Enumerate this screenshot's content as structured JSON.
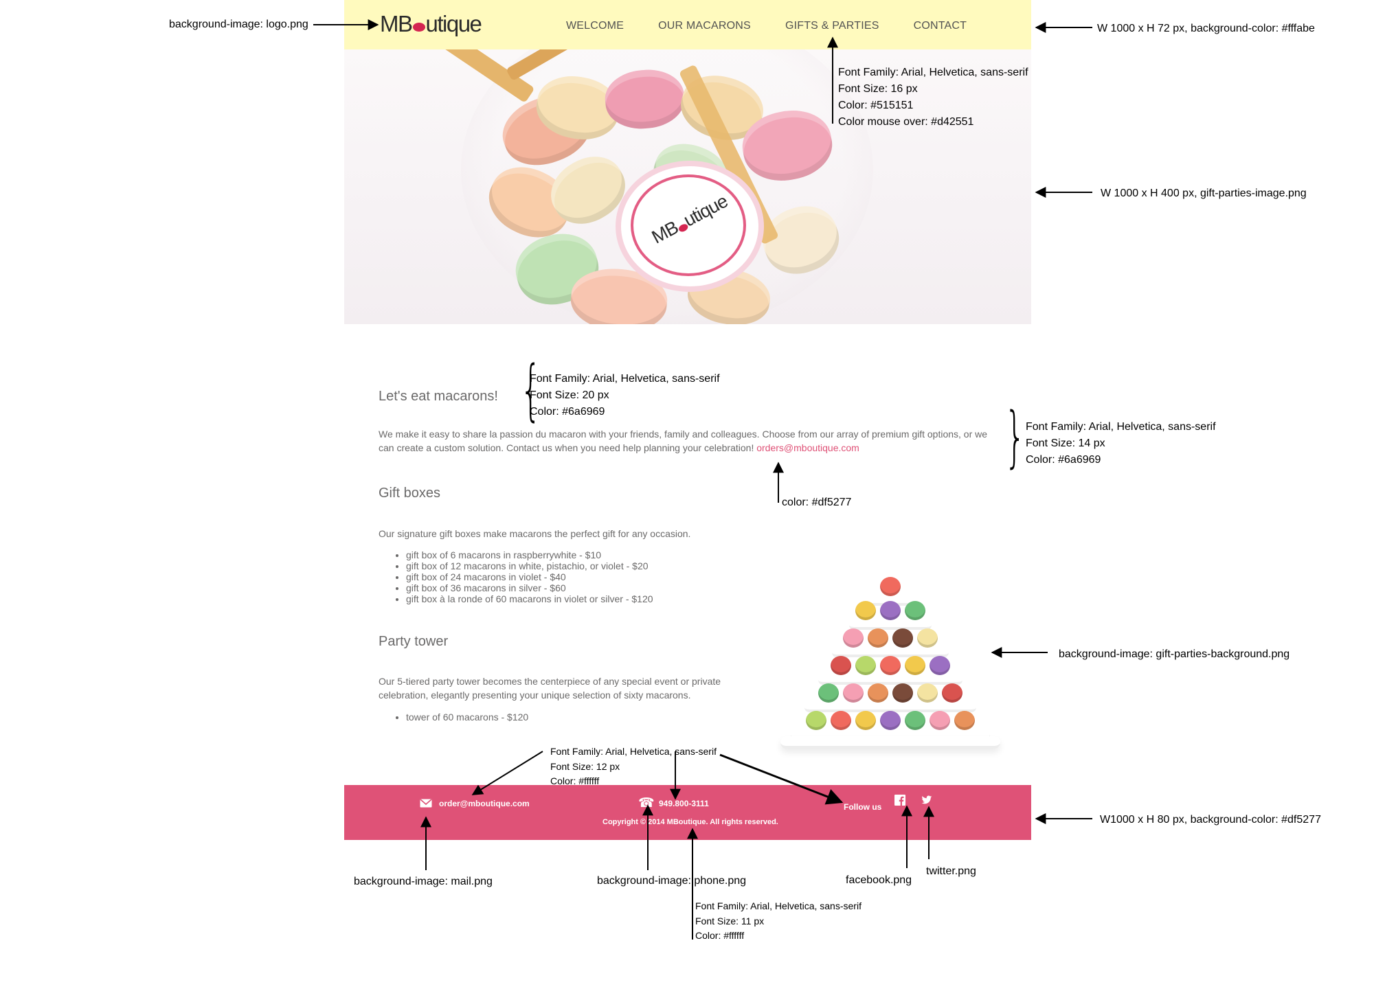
{
  "header": {
    "logo_text_left": "MB",
    "logo_text_right": "utique",
    "nav": [
      "WELCOME",
      "OUR MACARONS",
      "GIFTS & PARTIES",
      "CONTACT"
    ]
  },
  "hero": {
    "label_left": "MB",
    "label_right": "utique"
  },
  "content": {
    "title": "Let's eat macarons!",
    "intro": "We make it easy to share la passion du macaron with your friends, family and colleagues. Choose from our array of premium gift options, or we can create a custom solution. Contact us when you need help planning your celebration!",
    "email_link": "orders@mboutique.com",
    "gift_title": "Gift boxes",
    "gift_text": "Our signature gift boxes make macarons the perfect gift for any occasion.",
    "gift_items": [
      "gift box of 6 macarons in raspberrywhite - $10",
      "gift box of 12 macarons in white, pistachio, or violet - $20",
      "gift box of 24 macarons in violet - $40",
      "gift box of 36 macarons in silver - $60",
      "gift box à la ronde of 60 macarons in violet or silver - $120"
    ],
    "party_title": "Party tower",
    "party_text": "Our 5-tiered party tower becomes the centerpiece of any special event or private celebration, elegantly presenting your unique selection of sixty macarons.",
    "party_items": [
      "tower of 60 macarons - $120"
    ]
  },
  "footer": {
    "email": "order@mboutique.com",
    "phone": "949.800-3111",
    "copyright": "Copyright © 2014 MBoutique. All rights reserved.",
    "follow": "Follow us"
  },
  "annotations": {
    "logo_bg": "background-image: logo.png",
    "header_dims": "W 1000 x H 72 px, background-color: #fffabe",
    "nav_font": [
      "Font Family: Arial, Helvetica, sans-serif",
      "Font Size: 16 px",
      "Color: #515151",
      "Color mouse over: #d42551"
    ],
    "hero_dims": "W 1000 x H 400 px, gift-parties-image.png",
    "title_font": [
      "Font Family: Arial, Helvetica, sans-serif",
      "Font Size: 20 px",
      "Color: #6a6969"
    ],
    "body_font": [
      "Font Family: Arial, Helvetica, sans-serif",
      "Font Size: 14 px",
      "Color: #6a6969"
    ],
    "link_color": "color: #df5277",
    "tower_bg": "background-image: gift-parties-background.png",
    "footer_font": [
      "Font Family: Arial, Helvetica, sans-serif",
      "Font Size: 12 px",
      "Color: #ffffff"
    ],
    "footer_dims": "W1000 x H 80 px, background-color: #df5277",
    "mail_bg": "background-image: mail.png",
    "phone_bg": "background-image: phone.png",
    "facebook": "facebook.png",
    "twitter": "twitter.png",
    "copyright_font": [
      "Font Family: Arial, Helvetica, sans-serif",
      "Font Size: 11 px",
      "Color: #ffffff"
    ]
  },
  "colors": {
    "header_bg": "#fffabe",
    "nav_text": "#515151",
    "nav_hover": "#d42551",
    "body_text": "#6a6969",
    "accent": "#df5277",
    "footer_bg": "#df5277"
  },
  "icons": [
    "mail-icon",
    "phone-icon",
    "facebook-icon",
    "twitter-icon"
  ]
}
